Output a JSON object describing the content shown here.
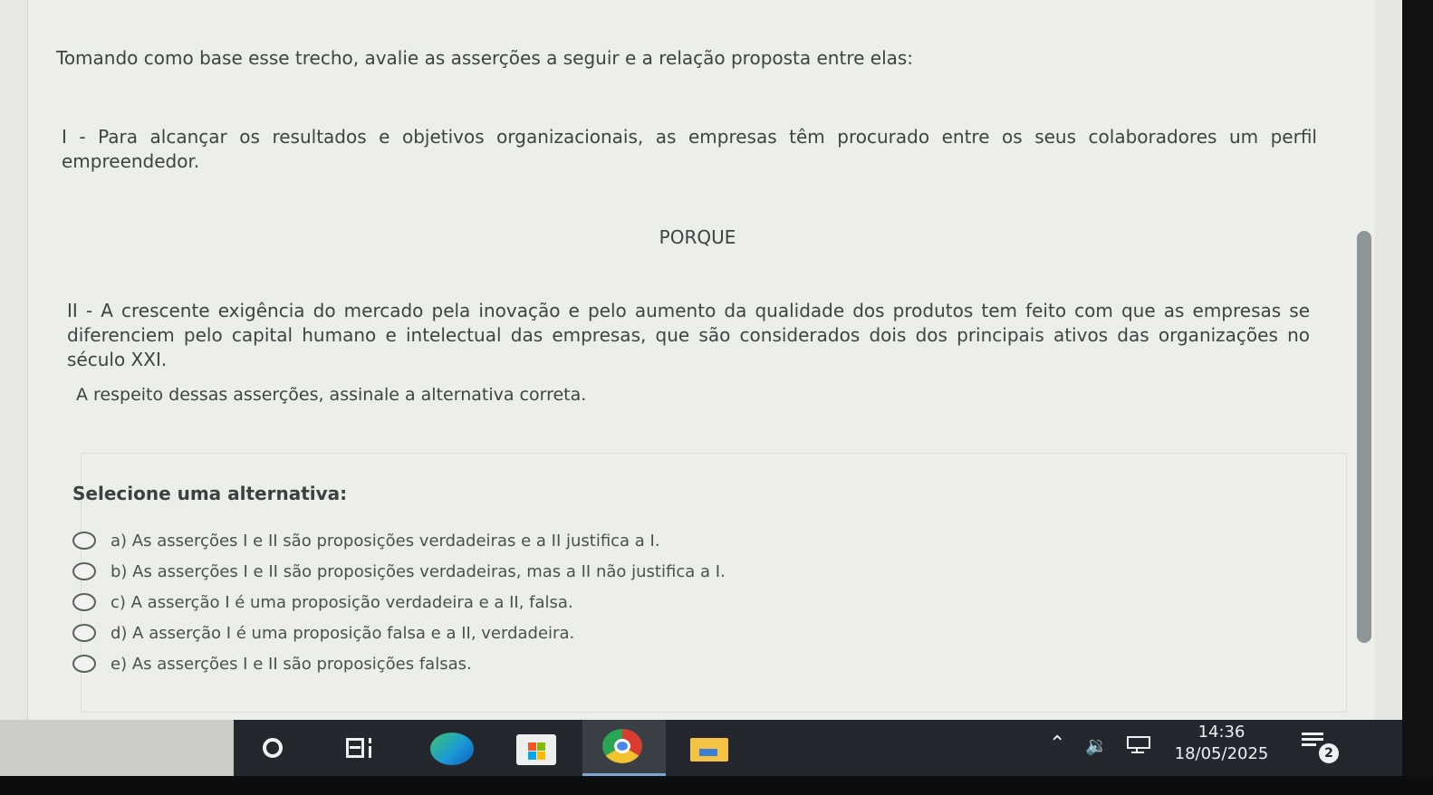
{
  "question": {
    "intro": "Tomando como base esse trecho, avalie as asserções a seguir e a relação proposta entre elas:",
    "assertion_1": "I - Para alcançar os resultados e objetivos organizacionais, as empresas têm procurado entre os seus colaboradores um perfil empreendedor.",
    "connector": "PORQUE",
    "assertion_2": "II - A crescente exigência do mercado pela inovação e pelo aumento da qualidade dos produtos tem feito com que as empresas se diferenciem pelo capital humano e intelectual das empresas, que são considerados dois dos principais ativos das organizações no século XXI.",
    "prompt": "A respeito dessas asserções, assinale a alternativa correta."
  },
  "answers": {
    "heading": "Selecione uma alternativa:",
    "options": [
      {
        "label": "a) As asserções I e II são proposições verdadeiras e a II justifica a I."
      },
      {
        "label": "b) As asserções I e II são proposições verdadeiras, mas a II não justifica a I."
      },
      {
        "label": "c) A asserção I é uma proposição verdadeira e a II, falsa."
      },
      {
        "label": "d) A asserção I é uma proposição falsa e a II, verdadeira."
      },
      {
        "label": "e) As asserções I e II são proposições falsas."
      }
    ]
  },
  "taskbar": {
    "apps": [
      "cortana-icon",
      "task-view-icon",
      "edge-icon",
      "store-icon",
      "chrome-icon",
      "file-explorer-icon"
    ],
    "time": "14:36",
    "date": "18/05/2025",
    "notification_count": "2"
  }
}
